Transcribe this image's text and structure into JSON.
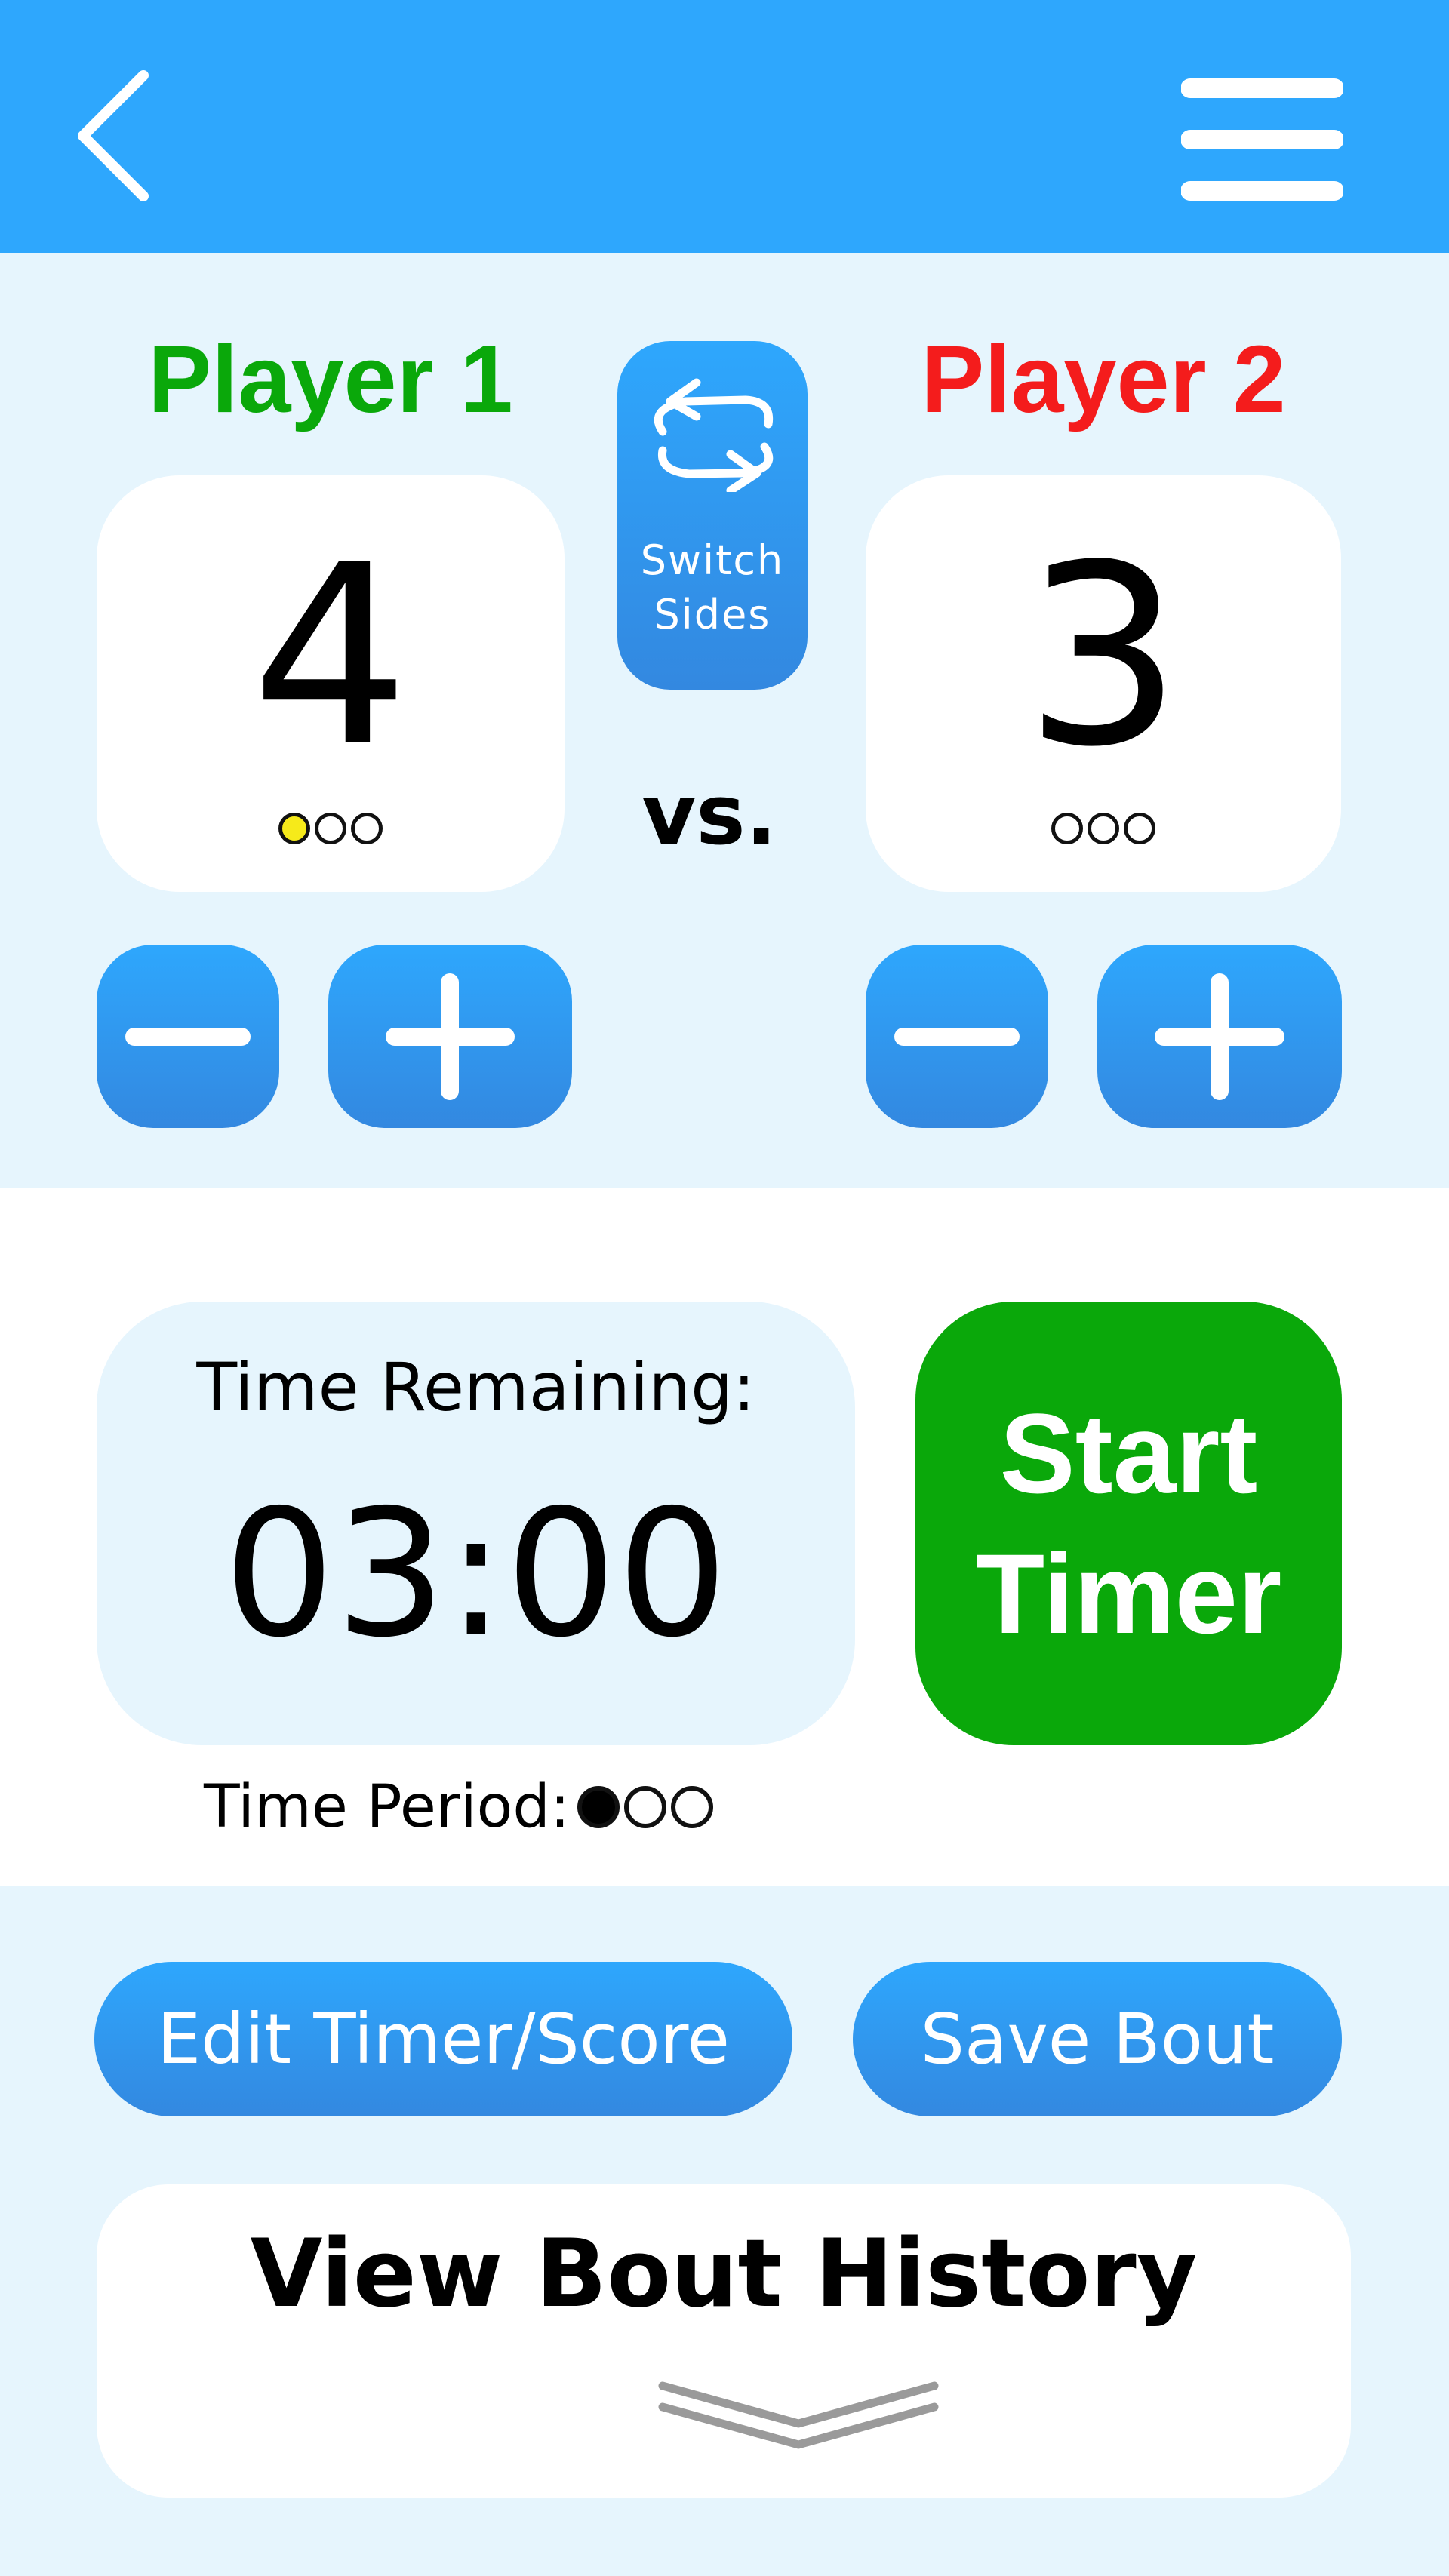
{
  "header": {
    "back_icon": "chevron-left-icon",
    "menu_icon": "hamburger-menu-icon",
    "background": "#2ea7fd"
  },
  "players": [
    {
      "name": "Player 1",
      "color": "#0aa80a",
      "score": "4",
      "indicators": [
        "filled",
        "empty",
        "empty"
      ]
    },
    {
      "name": "Player 2",
      "color": "#f41c1c",
      "score": "3",
      "indicators": [
        "empty",
        "empty",
        "empty"
      ]
    }
  ],
  "switch_sides": {
    "icon": "swap-arrows-icon",
    "label": "Switch\nSides"
  },
  "vs_label": "vs.",
  "score_controls": {
    "minus_icon": "minus-icon",
    "plus_icon": "plus-icon"
  },
  "timer": {
    "label": "Time Remaining:",
    "value": "03:00",
    "start_label": "Start\nTimer",
    "start_color": "#0aa80a",
    "period_label": "Time Period:",
    "period_indicators": [
      "filled",
      "empty",
      "empty"
    ]
  },
  "actions": {
    "edit_label": "Edit Timer/Score",
    "save_label": "Save Bout"
  },
  "history": {
    "label": "View Bout History",
    "icon": "double-chevron-down-icon"
  }
}
